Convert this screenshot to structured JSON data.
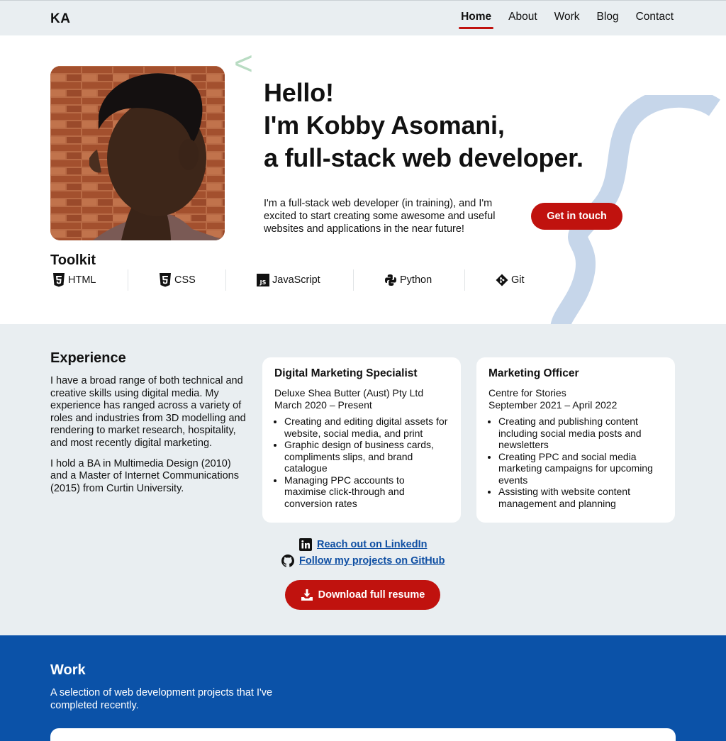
{
  "nav": {
    "logo": "KA",
    "links": [
      "Home",
      "About",
      "Work",
      "Blog",
      "Contact"
    ],
    "active": "Home"
  },
  "hero": {
    "title_lines": [
      "Hello!",
      "I'm Kobby Asomani,",
      "a full-stack web developer."
    ],
    "description": "I'm a full-stack web developer (in training), and I'm excited to start creating some awesome and useful websites and applications in the near future!",
    "cta": "Get in touch",
    "deco_chevron": "<"
  },
  "toolkit": {
    "title": "Toolkit",
    "items": [
      {
        "label": "HTML",
        "icon": "html5-icon"
      },
      {
        "label": "CSS",
        "icon": "css3-icon"
      },
      {
        "label": "JavaScript",
        "icon": "javascript-icon"
      },
      {
        "label": "Python",
        "icon": "python-icon"
      },
      {
        "label": "Git",
        "icon": "git-icon"
      }
    ]
  },
  "experience": {
    "title": "Experience",
    "paragraphs": [
      "I have a broad range of both technical and creative skills using digital media. My experience has ranged across a variety of roles and industries from 3D modelling and rendering to market research, hospitality, and most recently digital marketing.",
      "I hold a BA in Multimedia Design (2010) and a Master of Internet Communications (2015) from Curtin University."
    ],
    "jobs": [
      {
        "title": "Digital Marketing Specialist",
        "company": "Deluxe Shea Butter (Aust) Pty Ltd",
        "dates": "March 2020 – Present",
        "points": [
          "Creating and editing digital assets for website, social media, and print",
          "Graphic design of business cards, compliments slips, and brand catalogue",
          "Managing PPC accounts to maximise click-through and conversion rates"
        ]
      },
      {
        "title": "Marketing Officer",
        "company": "Centre for Stories",
        "dates": "September 2021 – April 2022",
        "points": [
          "Creating and publishing content including social media posts and newsletters",
          "Creating PPC and social media marketing campaigns for upcoming events",
          "Assisting with website content management and planning"
        ]
      }
    ],
    "linkedin": "Reach out on LinkedIn",
    "github": "Follow my projects on GitHub",
    "download": "Download full resume"
  },
  "work": {
    "title": "Work",
    "subtitle": "A selection of web development projects that I've completed recently."
  },
  "colors": {
    "accent": "#c0120e",
    "brand_blue": "#0b52a8",
    "light_bg": "#e9eef1",
    "link": "#0f4fa3"
  }
}
